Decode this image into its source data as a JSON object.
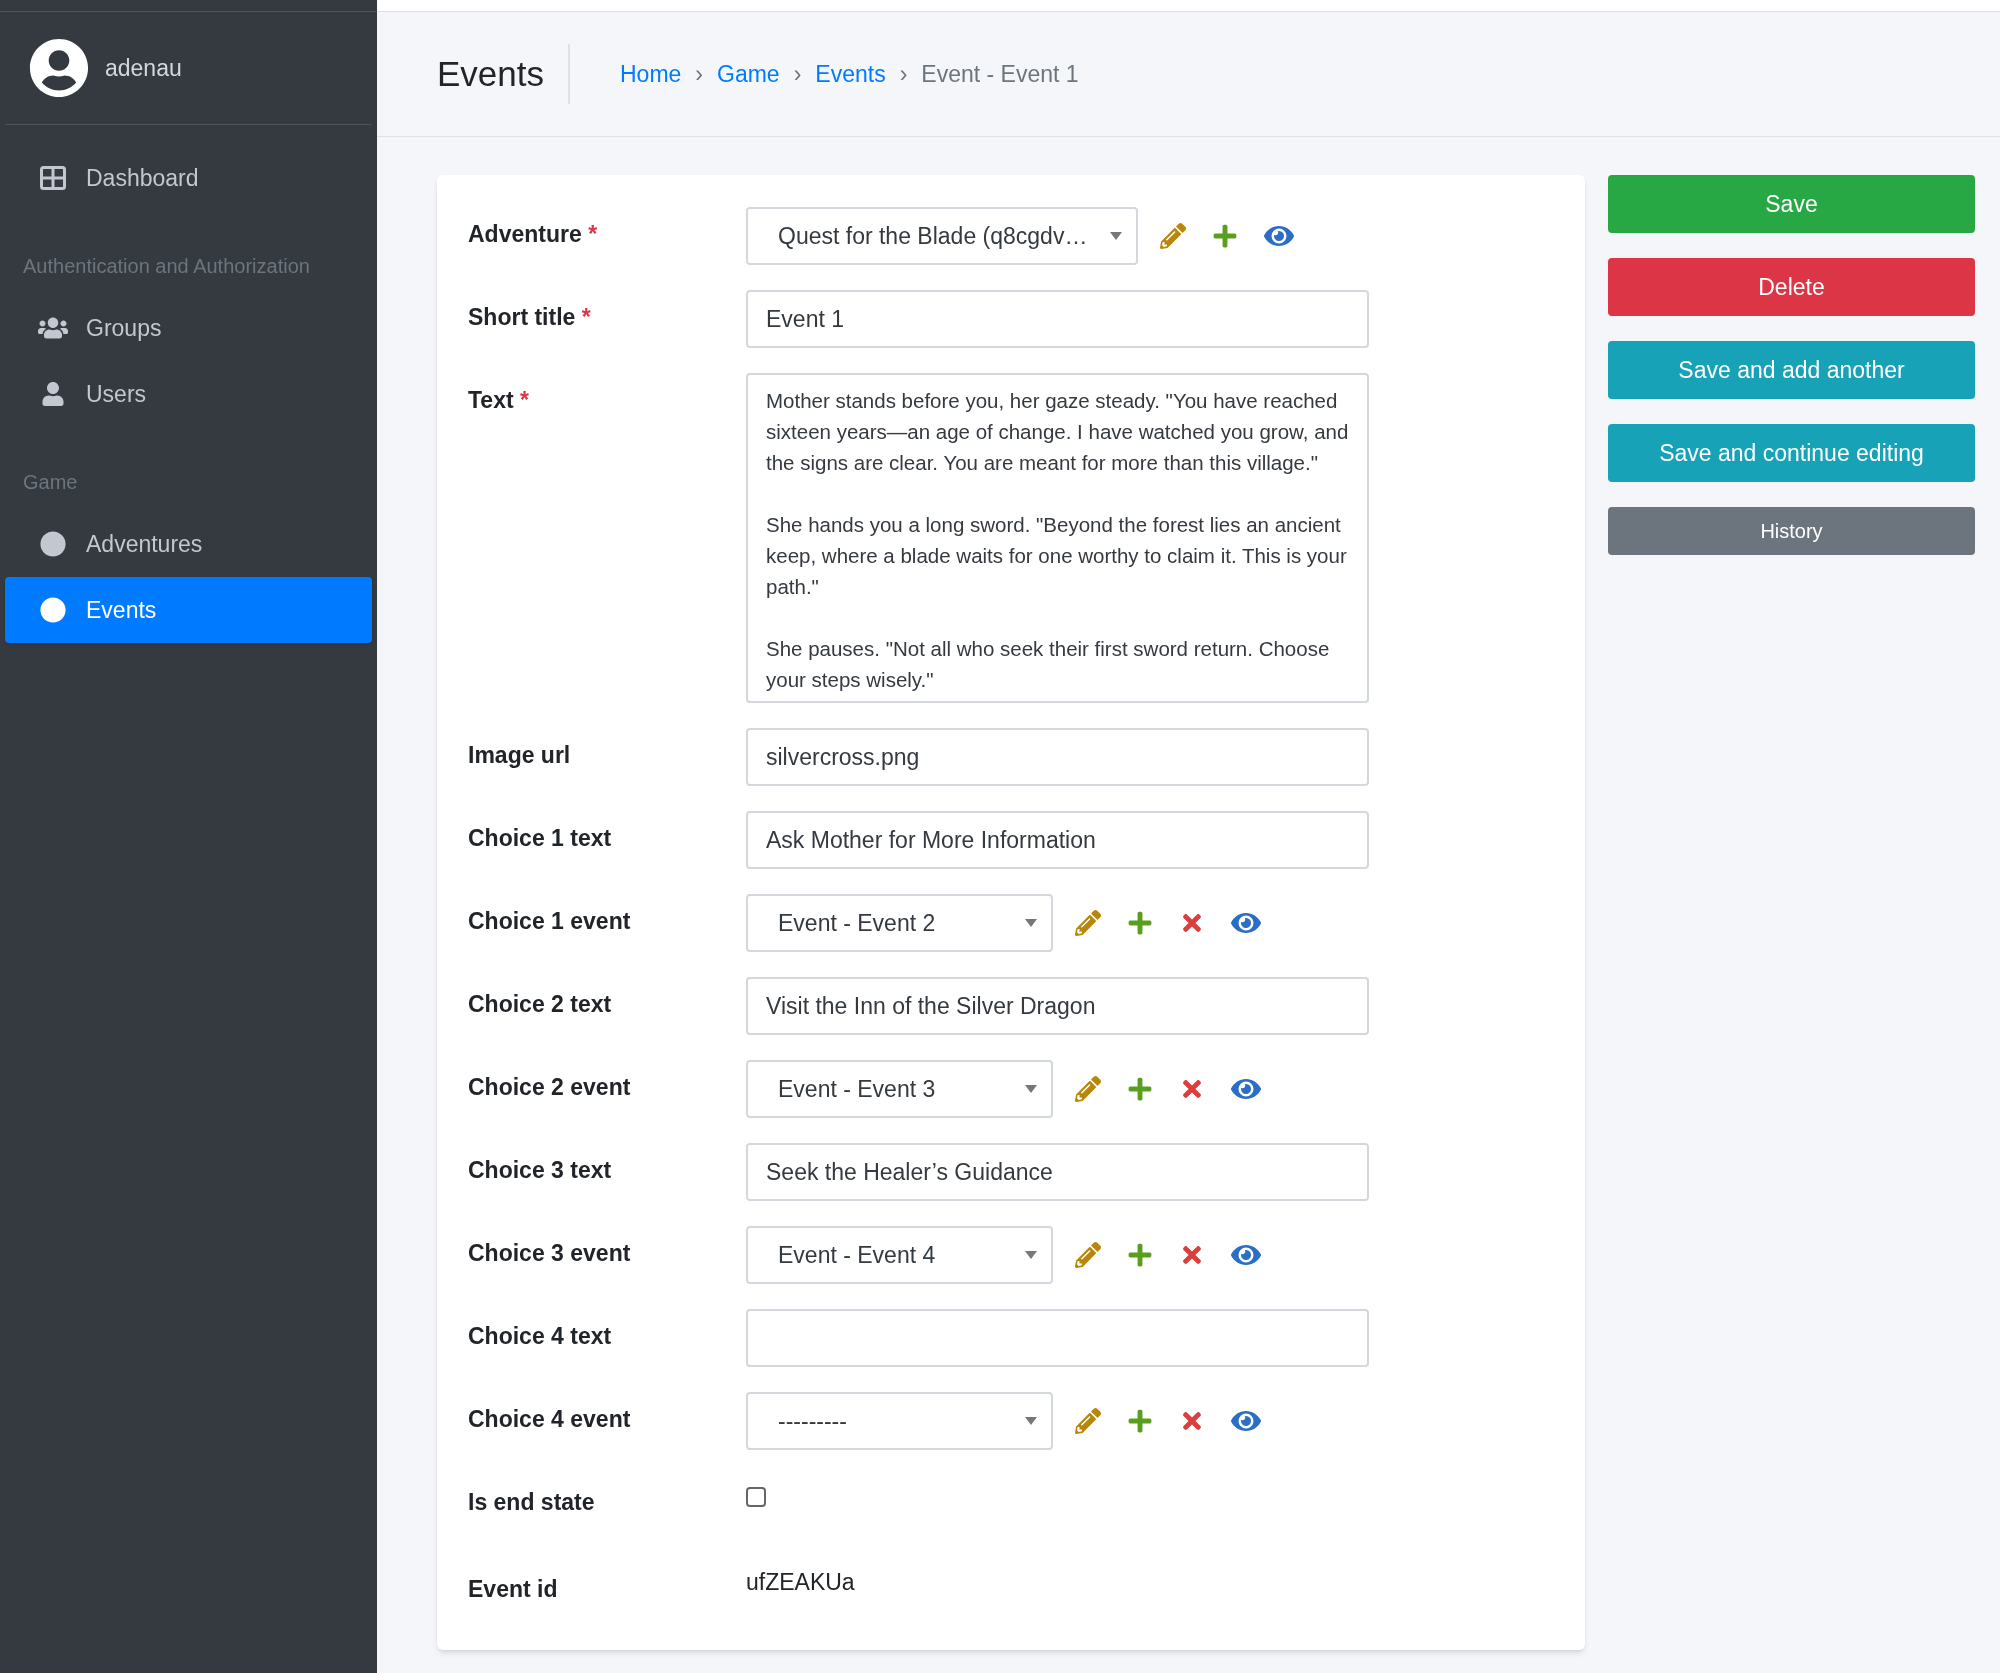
{
  "sidebar": {
    "user": "adenau",
    "sections": [
      {
        "items": [
          {
            "label": "Dashboard",
            "kind": "dashboard",
            "selected": false
          }
        ]
      },
      {
        "title": "Authentication and Authorization",
        "items": [
          {
            "label": "Groups",
            "kind": "groups",
            "selected": false
          },
          {
            "label": "Users",
            "kind": "user",
            "selected": false
          }
        ]
      },
      {
        "title": "Game",
        "items": [
          {
            "label": "Adventures",
            "kind": "dot",
            "selected": false
          },
          {
            "label": "Events",
            "kind": "dot",
            "selected": true
          }
        ]
      }
    ]
  },
  "header": {
    "title": "Events",
    "breadcrumbs": [
      {
        "label": "Home",
        "link": true
      },
      {
        "label": "Game",
        "link": true
      },
      {
        "label": "Events",
        "link": true
      },
      {
        "label": "Event - Event 1",
        "link": false
      }
    ],
    "separator": "›"
  },
  "form": {
    "fields": [
      {
        "label": "Adventure",
        "required": true,
        "kind": "select",
        "value": "Quest for the Blade (q8cgdv…",
        "can_delete": false
      },
      {
        "label": "Short title",
        "required": true,
        "kind": "text",
        "value": "Event 1"
      },
      {
        "label": "Text",
        "required": true,
        "kind": "textarea",
        "value": "Mother stands before you, her gaze steady. \"You have reached sixteen years—an age of change. I have watched you grow, and the signs are clear. You are meant for more than this village.\"\n\nShe hands you a long sword. \"Beyond the forest lies an ancient keep, where a blade waits for one worthy to claim it. This is your path.\"\n\nShe pauses. \"Not all who seek their first sword return. Choose your steps wisely.\""
      },
      {
        "label": "Image url",
        "required": false,
        "kind": "text",
        "value": "silvercross.png"
      },
      {
        "label": "Choice 1 text",
        "required": false,
        "kind": "text",
        "value": "Ask Mother for More Information"
      },
      {
        "label": "Choice 1 event",
        "required": false,
        "kind": "select",
        "value": "Event - Event 2",
        "can_delete": true
      },
      {
        "label": "Choice 2 text",
        "required": false,
        "kind": "text",
        "value": "Visit the Inn of the Silver Dragon"
      },
      {
        "label": "Choice 2 event",
        "required": false,
        "kind": "select",
        "value": "Event - Event 3",
        "can_delete": true
      },
      {
        "label": "Choice 3 text",
        "required": false,
        "kind": "text",
        "value": "Seek the Healer’s Guidance"
      },
      {
        "label": "Choice 3 event",
        "required": false,
        "kind": "select",
        "value": "Event - Event 4",
        "can_delete": true
      },
      {
        "label": "Choice 4 text",
        "required": false,
        "kind": "text"
      },
      {
        "label": "Choice 4 event",
        "required": false,
        "kind": "select",
        "value": "---------",
        "can_delete": true
      },
      {
        "label": "Is end state",
        "required": false,
        "kind": "checkbox",
        "checked": false
      },
      {
        "label": "Event id",
        "required": false,
        "kind": "readonly",
        "value": "ufZEAKUa"
      }
    ],
    "required_mark": "*"
  },
  "actions": [
    {
      "label": "Save",
      "kind": "save"
    },
    {
      "label": "Delete",
      "kind": "delete"
    },
    {
      "label": "Save and add another",
      "kind": "secondary"
    },
    {
      "label": "Save and continue editing",
      "kind": "secondary"
    },
    {
      "label": "History",
      "kind": "history"
    }
  ]
}
